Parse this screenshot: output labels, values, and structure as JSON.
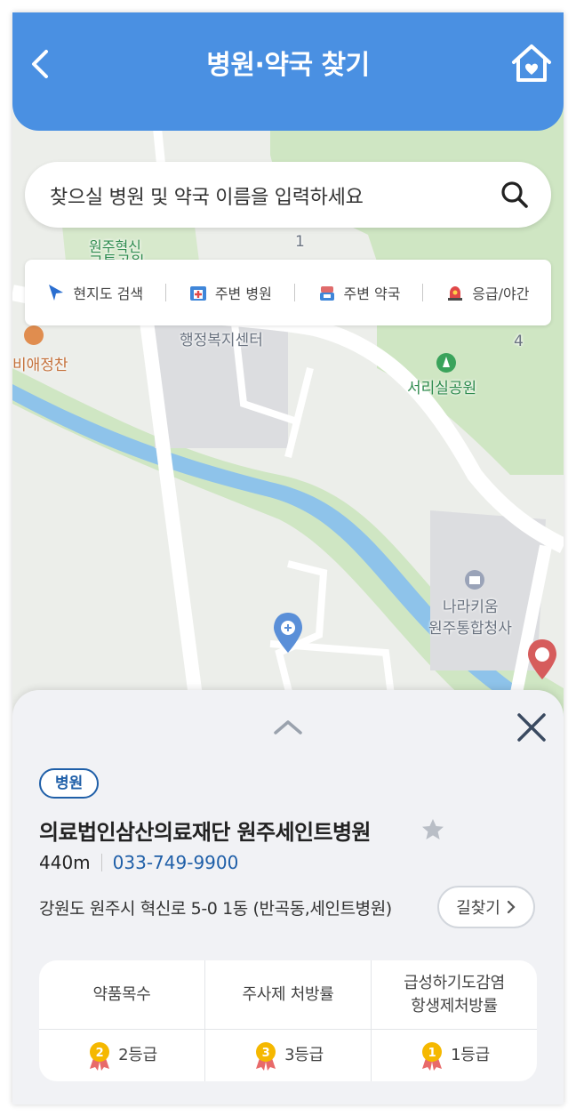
{
  "header": {
    "title": "병원·약국 찾기"
  },
  "search": {
    "placeholder": "찾으실 병원 및 약국 이름을 입력하세요"
  },
  "filters": [
    {
      "label": "현지도 검색",
      "icon": "location-arrow-icon"
    },
    {
      "label": "주변 병원",
      "icon": "hospital-icon"
    },
    {
      "label": "주변 약국",
      "icon": "pharmacy-icon"
    },
    {
      "label": "응급/야간",
      "icon": "siren-icon"
    }
  ],
  "map_labels": {
    "park1_top": "원주혁신",
    "park1": "교통공원",
    "cafe": "비애정찬",
    "center": "행정복지센터",
    "park2": "서리실공원",
    "gov": "나라키움",
    "gov2": "원주통합청사",
    "road_num1": "1",
    "road_num4": "4"
  },
  "detail": {
    "category": "병원",
    "name": "의료법인삼산의료재단 원주세인트병원",
    "distance": "440m",
    "phone": "033-749-9900",
    "address": "강원도 원주시 혁신로 5-0 1동 (반곡동,세인트병원)",
    "route_label": "길찾기",
    "ratings": {
      "headers": [
        "약품목수",
        "주사제 처방률",
        "급성하기도감염\n항생제처방률"
      ],
      "grades": [
        {
          "medal": "2",
          "label": "2등급"
        },
        {
          "medal": "3",
          "label": "3등급"
        },
        {
          "medal": "1",
          "label": "1등급"
        }
      ]
    }
  },
  "colors": {
    "header_bg": "#4a90e2",
    "accent": "#1f5fa8",
    "medal": "#f5b800"
  }
}
